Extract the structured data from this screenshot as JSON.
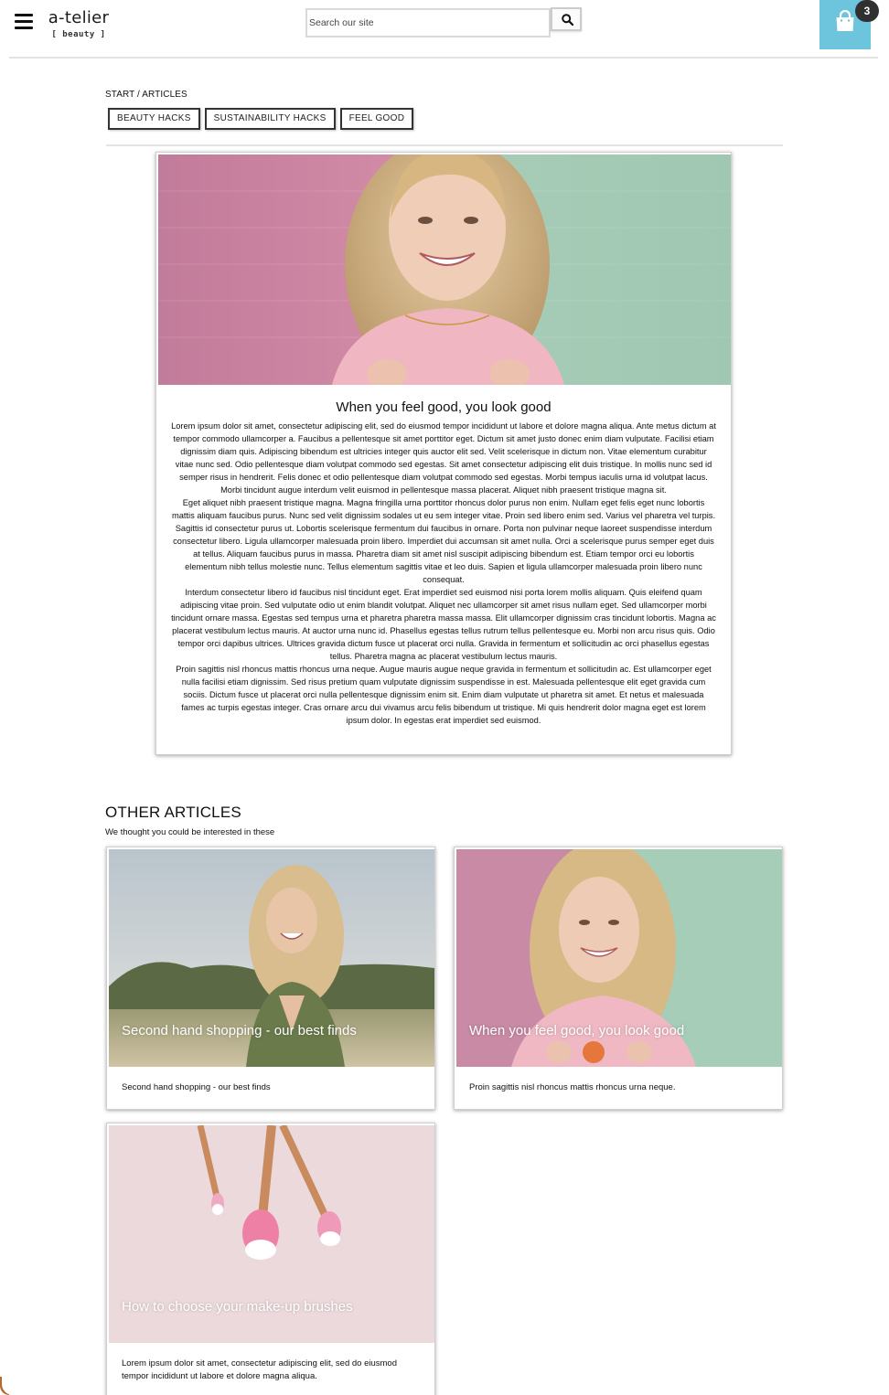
{
  "header": {
    "logo_main": "a-telier",
    "logo_sub": "[ beauty ]",
    "search_placeholder": "Search our site",
    "cart_count": "3",
    "cart_color": "#6cc4dd"
  },
  "breadcrumb": "START / ARTICLES",
  "tags": [
    "BEAUTY HACKS",
    "SUSTAINABILITY HACKS",
    "FEEL GOOD"
  ],
  "article": {
    "title": "When you feel good, you look good",
    "paragraphs": [
      "Lorem ipsum dolor sit amet, consectetur adipiscing elit, sed do eiusmod tempor incididunt ut labore et dolore magna aliqua. Ante metus dictum at tempor commodo ullamcorper a. Faucibus a pellentesque sit amet porttitor eget. Dictum sit amet justo donec enim diam vulputate. Facilisi etiam dignissim diam quis. Adipiscing bibendum est ultricies integer quis auctor elit sed. Velit scelerisque in dictum non. Vitae elementum curabitur vitae nunc sed. Odio pellentesque diam volutpat commodo sed egestas. Sit amet consectetur adipiscing elit duis tristique. In mollis nunc sed id semper risus in hendrerit. Felis donec et odio pellentesque diam volutpat commodo sed egestas. Morbi tempus iaculis urna id volutpat lacus. Morbi tincidunt augue interdum velit euismod in pellentesque massa placerat. Aliquet nibh praesent tristique magna sit.",
      "Eget aliquet nibh praesent tristique magna. Magna fringilla urna porttitor rhoncus dolor purus non enim. Nullam eget felis eget nunc lobortis mattis aliquam faucibus purus. Nunc sed velit dignissim sodales ut eu sem integer vitae. Proin sed libero enim sed. Varius vel pharetra vel turpis. Sagittis id consectetur purus ut. Lobortis scelerisque fermentum dui faucibus in ornare. Porta non pulvinar neque laoreet suspendisse interdum consectetur libero. Ligula ullamcorper malesuada proin libero. Imperdiet dui accumsan sit amet nulla. Orci a scelerisque purus semper eget duis at tellus. Aliquam faucibus purus in massa. Pharetra diam sit amet nisl suscipit adipiscing bibendum est. Etiam tempor orci eu lobortis elementum nibh tellus molestie nunc. Tellus elementum sagittis vitae et leo duis. Sapien et ligula ullamcorper malesuada proin libero nunc consequat.",
      "Interdum consectetur libero id faucibus nisl tincidunt eget. Erat imperdiet sed euismod nisi porta lorem mollis aliquam. Quis eleifend quam adipiscing vitae proin. Sed vulputate odio ut enim blandit volutpat. Aliquet nec ullamcorper sit amet risus nullam eget. Sed ullamcorper morbi tincidunt ornare massa. Egestas sed tempus urna et pharetra pharetra massa massa. Elit ullamcorper dignissim cras tincidunt lobortis. Magna ac placerat vestibulum lectus mauris. At auctor urna nunc id. Phasellus egestas tellus rutrum tellus pellentesque eu. Morbi non arcu risus quis. Odio tempor orci dapibus ultrices. Ultrices gravida dictum fusce ut placerat orci nulla. Gravida in fermentum et sollicitudin ac orci phasellus egestas tellus. Pharetra magna ac placerat vestibulum lectus mauris.",
      "Proin sagittis nisl rhoncus mattis rhoncus urna neque. Augue mauris augue neque gravida in fermentum et sollicitudin ac. Est ullamcorper eget nulla facilisi etiam dignissim. Sed risus pretium quam vulputate dignissim suspendisse in est. Malesuada pellentesque elit eget gravida cum sociis. Dictum fusce ut placerat orci nulla pellentesque dignissim enim sit. Enim diam vulputate ut pharetra sit amet. Et netus et malesuada fames ac turpis egestas integer. Cras ornare arcu dui vivamus arcu felis bibendum ut tristique. Mi quis hendrerit dolor magna eget est lorem ipsum dolor. In egestas erat imperdiet sed euismod."
    ]
  },
  "other": {
    "title": "OTHER ARTICLES",
    "subtitle": "We thought you could be interested in these",
    "cards": [
      {
        "overlay": "Second hand shopping - our best finds",
        "text": "Second hand shopping - our best finds"
      },
      {
        "overlay": "When you feel good, you look good",
        "text": "Proin sagittis nisl rhoncus mattis rhoncus urna neque."
      },
      {
        "overlay": "How to choose your make-up brushes",
        "text": "Lorem ipsum dolor sit amet, consectetur adipiscing elit, sed do eiusmod tempor incididunt ut labore et dolore magna aliqua."
      }
    ]
  }
}
